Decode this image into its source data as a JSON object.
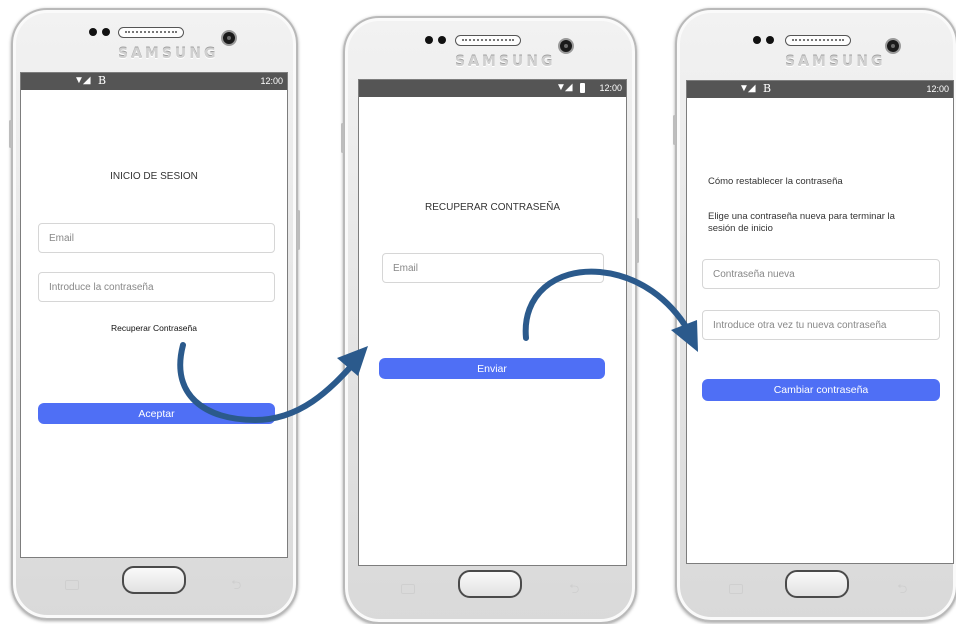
{
  "device": {
    "brand": "SAMSUNG"
  },
  "status": {
    "time": "12:00",
    "icons": "▼◢"
  },
  "screen1": {
    "title": "INICIO DE SESION",
    "email_placeholder": "Email",
    "password_placeholder": "Introduce la contraseña",
    "recover_link": "Recuperar Contraseña",
    "submit_label": "Aceptar"
  },
  "screen2": {
    "title": "RECUPERAR CONTRASEÑA",
    "email_placeholder": "Email",
    "submit_label": "Enviar"
  },
  "screen3": {
    "heading": "Cómo restablecer la contraseña",
    "description": "Elige una contraseña nueva para terminar la sesión de inicio",
    "new_password_placeholder": "Contraseña nueva",
    "repeat_password_placeholder": "Introduce otra vez tu nueva contraseña",
    "submit_label": "Cambiar contraseña"
  },
  "colors": {
    "accent": "#4f6ff5",
    "arrow": "#2b5a8c",
    "statusbar": "#555555"
  },
  "icons": [
    "wifi-icon",
    "signal-icon",
    "battery-icon",
    "flow-arrow-icon"
  ]
}
